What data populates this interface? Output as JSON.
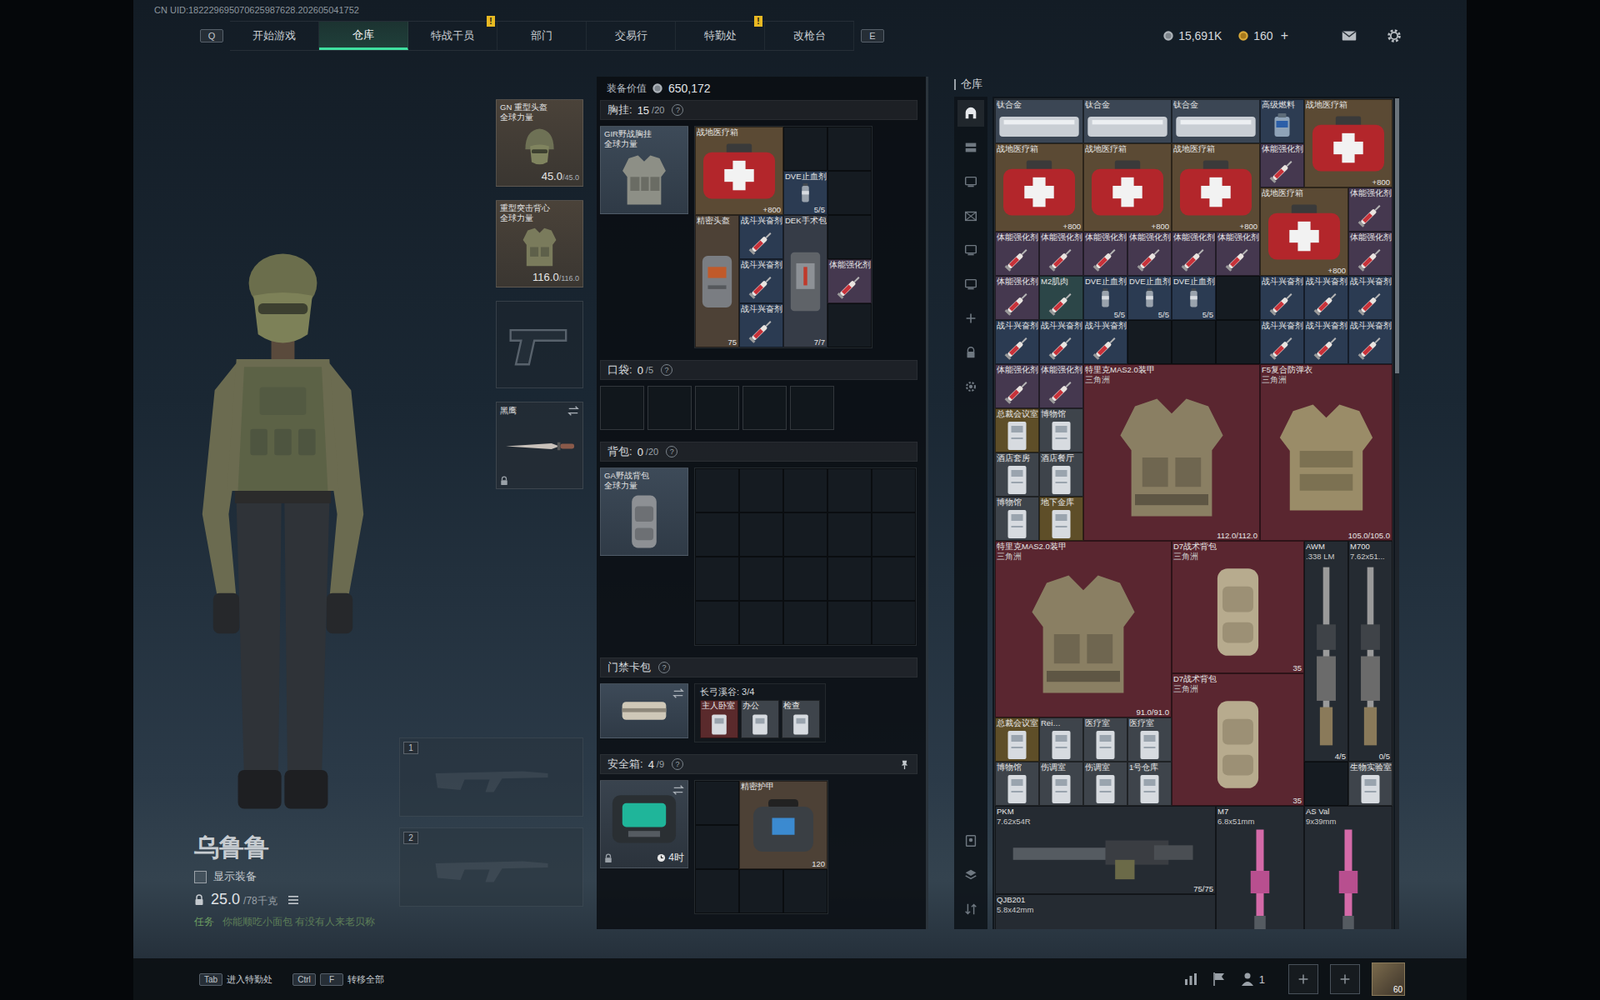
{
  "uid": "CN UID:182229695070625987628.202605041752",
  "nav": {
    "prev_key": "Q",
    "next_key": "E",
    "alert_mark": "!",
    "tabs": [
      {
        "label": "开始游戏",
        "selected": false,
        "alert": false
      },
      {
        "label": "仓库",
        "selected": true,
        "alert": false
      },
      {
        "label": "特战干员",
        "selected": false,
        "alert": true
      },
      {
        "label": "部门",
        "selected": false,
        "alert": false
      },
      {
        "label": "交易行",
        "selected": false,
        "alert": false
      },
      {
        "label": "特勤处",
        "selected": false,
        "alert": true
      },
      {
        "label": "改枪台",
        "selected": false,
        "alert": false
      }
    ]
  },
  "currency": {
    "coins": "15,691K",
    "bonds": "160",
    "add": "+"
  },
  "character": {
    "name": "乌鲁鲁",
    "show_gear": {
      "label": "显示装备",
      "checked": false
    },
    "weight": "25.0",
    "capacity": "/78千克",
    "task_label": "任务",
    "task": "你能顺吃小面包 有没有人来老贝称"
  },
  "gear": {
    "helmet": {
      "name": "GN 重型头盔",
      "brand": "全球力量",
      "durability": "45.0",
      "max": "/45.0"
    },
    "armor": {
      "name": "重型突击背心",
      "brand": "全球力量",
      "durability": "116.0",
      "max": "/116.0"
    },
    "pistol": {
      "empty": true
    },
    "melee": {
      "name": "黑鹰",
      "locked": true
    }
  },
  "weapons": [
    {
      "slot": "1",
      "empty": true
    },
    {
      "slot": "2",
      "empty": true
    }
  ],
  "loadout": {
    "value_label": "装备价值",
    "value": "650,172",
    "help": "?",
    "chest": {
      "label": "胸挂:",
      "count": "15",
      "capacity": "/20",
      "container": {
        "name": "GIR野战胸挂",
        "brand": "全球力量"
      },
      "items": [
        {
          "name": "战地医疗箱",
          "kind": "medkit",
          "sub": "",
          "value": "+800",
          "color": "#5b4a34"
        },
        {
          "name": "",
          "kind": "empty",
          "sub": "",
          "value": "",
          "color": "#151b21"
        },
        {
          "name": "",
          "kind": "empty",
          "sub": "",
          "value": "",
          "color": "#151b21"
        },
        {
          "name": "DVE止血剂",
          "kind": "spray",
          "sub": "",
          "value": "5/5",
          "color": "#2b3b52"
        },
        {
          "name": "",
          "kind": "empty",
          "sub": "",
          "value": "",
          "color": "#151b21"
        },
        {
          "name": "精密头盔",
          "kind": "helmet",
          "sub": "",
          "value": "75",
          "color": "#4d4136"
        },
        {
          "name": "战斗兴奋剂",
          "kind": "syringe",
          "sub": "",
          "value": "",
          "color": "#2b3b52"
        },
        {
          "name": "DEK手术包",
          "kind": "surgkit",
          "sub": "",
          "value": "7/7",
          "color": "#363c47"
        },
        {
          "name": "",
          "kind": "empty",
          "sub": "",
          "value": "",
          "color": "#151b21"
        },
        {
          "name": "战斗兴奋剂",
          "kind": "syringe",
          "sub": "",
          "value": "",
          "color": "#2b3b52"
        },
        {
          "name": "体能强化剂",
          "kind": "syringe",
          "sub": "",
          "value": "",
          "color": "#45384f"
        },
        {
          "name": "战斗兴奋剂",
          "kind": "syringe",
          "sub": "",
          "value": "",
          "color": "#2b3b52"
        },
        {
          "name": "",
          "kind": "empty",
          "sub": "",
          "value": "",
          "color": "#151b21"
        }
      ]
    },
    "pocket": {
      "label": "口袋:",
      "count": "0",
      "capacity": "/5"
    },
    "backpack": {
      "label": "背包:",
      "count": "0",
      "capacity": "/20",
      "container": {
        "name": "GA野战背包",
        "brand": "全球力量"
      }
    },
    "keycards": {
      "label": "门禁卡包",
      "map": "长弓溪谷: 3/4",
      "cards": [
        {
          "name": "主人卧室",
          "color": "#5a2a2c"
        },
        {
          "name": "办公",
          "color": "#3e444b"
        },
        {
          "name": "检查",
          "color": "#3e444b"
        }
      ]
    },
    "safebox": {
      "label": "安全箱:",
      "count": "4",
      "capacity": "/9",
      "timer": "4时",
      "items": [
        {
          "name": "",
          "kind": "empty",
          "sub": "",
          "value": "",
          "color": "#151b21"
        },
        {
          "name": "精密护甲",
          "kind": "armorcase",
          "sub": "",
          "value": "120",
          "color": "#4d4136"
        },
        {
          "name": "",
          "kind": "empty",
          "sub": "",
          "value": "",
          "color": "#151b21"
        },
        {
          "name": "",
          "kind": "empty",
          "sub": "",
          "value": "",
          "color": "#151b21"
        },
        {
          "name": "",
          "kind": "empty",
          "sub": "",
          "value": "",
          "color": "#151b21"
        },
        {
          "name": "",
          "kind": "empty",
          "sub": "",
          "value": "",
          "color": "#151b21"
        }
      ]
    }
  },
  "warehouse": {
    "title": "仓库",
    "sidebar": [
      {
        "kind": "home",
        "selected": true
      },
      {
        "kind": "stash",
        "selected": false
      },
      {
        "kind": "monitor",
        "selected": false
      },
      {
        "kind": "crate",
        "selected": false
      },
      {
        "kind": "monitor",
        "selected": false
      },
      {
        "kind": "monitor",
        "selected": false
      },
      {
        "kind": "add",
        "selected": false
      },
      {
        "kind": "lock",
        "selected": false
      },
      {
        "kind": "settings",
        "selected": false
      }
    ],
    "sidebar_bottom": [
      {
        "kind": "badge",
        "selected": false
      },
      {
        "kind": "layers",
        "selected": false
      },
      {
        "kind": "sort",
        "selected": false
      }
    ],
    "items": [
      {
        "name": "钛合金",
        "kind": "ingot",
        "sub": "",
        "value": "",
        "color": "#3b4654"
      },
      {
        "name": "钛合金",
        "kind": "ingot",
        "sub": "",
        "value": "",
        "color": "#3b4654"
      },
      {
        "name": "钛合金",
        "kind": "ingot",
        "sub": "",
        "value": "",
        "color": "#3b4654"
      },
      {
        "name": "高级燃料",
        "kind": "fuel",
        "sub": "",
        "value": "",
        "color": "#2d3c52"
      },
      {
        "name": "战地医疗箱",
        "kind": "medkit",
        "sub": "",
        "value": "+800",
        "color": "#5b4a34"
      },
      {
        "name": "战地医疗箱",
        "kind": "medkit",
        "sub": "",
        "value": "+800",
        "color": "#5b4a34"
      },
      {
        "name": "战地医疗箱",
        "kind": "medkit",
        "sub": "",
        "value": "+800",
        "color": "#5b4a34"
      },
      {
        "name": "战地医疗箱",
        "kind": "medkit",
        "sub": "",
        "value": "+800",
        "color": "#5b4a34"
      },
      {
        "name": "体能强化剂",
        "kind": "syringe",
        "sub": "",
        "value": "",
        "color": "#45384f"
      },
      {
        "name": "战地医疗箱",
        "kind": "medkit",
        "sub": "",
        "value": "+800",
        "color": "#5b4a34"
      },
      {
        "name": "体能强化剂",
        "kind": "syringe",
        "sub": "",
        "value": "",
        "color": "#45384f"
      },
      {
        "name": "体能强化剂",
        "kind": "syringe",
        "sub": "",
        "value": "",
        "color": "#45384f"
      },
      {
        "name": "体能强化剂",
        "kind": "syringe",
        "sub": "",
        "value": "",
        "color": "#45384f"
      },
      {
        "name": "体能强化剂",
        "kind": "syringe",
        "sub": "",
        "value": "",
        "color": "#45384f"
      },
      {
        "name": "体能强化剂",
        "kind": "syringe",
        "sub": "",
        "value": "",
        "color": "#45384f"
      },
      {
        "name": "体能强化剂",
        "kind": "syringe",
        "sub": "",
        "value": "",
        "color": "#45384f"
      },
      {
        "name": "体能强化剂",
        "kind": "syringe",
        "sub": "",
        "value": "",
        "color": "#45384f"
      },
      {
        "name": "体能强化剂",
        "kind": "syringe",
        "sub": "",
        "value": "",
        "color": "#45384f"
      },
      {
        "name": "体能强化剂",
        "kind": "syringe",
        "sub": "",
        "value": "",
        "color": "#45384f"
      },
      {
        "name": "M2肌肉",
        "kind": "syringe",
        "sub": "",
        "value": "",
        "color": "#2c4648"
      },
      {
        "name": "DVE止血剂",
        "kind": "spray",
        "sub": "",
        "value": "5/5",
        "color": "#2b3b52"
      },
      {
        "name": "DVE止血剂",
        "kind": "spray",
        "sub": "",
        "value": "5/5",
        "color": "#2b3b52"
      },
      {
        "name": "DVE止血剂",
        "kind": "spray",
        "sub": "",
        "value": "5/5",
        "color": "#2b3b52"
      },
      {
        "name": "",
        "kind": "empty",
        "sub": "",
        "value": "",
        "color": "#151b21"
      },
      {
        "name": "战斗兴奋剂",
        "kind": "syringe",
        "sub": "",
        "value": "",
        "color": "#2b3b52"
      },
      {
        "name": "战斗兴奋剂",
        "kind": "syringe",
        "sub": "",
        "value": "",
        "color": "#2b3b52"
      },
      {
        "name": "战斗兴奋剂",
        "kind": "syringe",
        "sub": "",
        "value": "",
        "color": "#2b3b52"
      },
      {
        "name": "战斗兴奋剂",
        "kind": "syringe",
        "sub": "",
        "value": "",
        "color": "#2b3b52"
      },
      {
        "name": "战斗兴奋剂",
        "kind": "syringe",
        "sub": "",
        "value": "",
        "color": "#2b3b52"
      },
      {
        "name": "战斗兴奋剂",
        "kind": "syringe",
        "sub": "",
        "value": "",
        "color": "#2b3b52"
      },
      {
        "name": "",
        "kind": "empty",
        "sub": "",
        "value": "",
        "color": "#151b21"
      },
      {
        "name": "",
        "kind": "empty",
        "sub": "",
        "value": "",
        "color": "#151b21"
      },
      {
        "name": "",
        "kind": "empty",
        "sub": "",
        "value": "",
        "color": "#151b21"
      },
      {
        "name": "战斗兴奋剂",
        "kind": "syringe",
        "sub": "",
        "value": "",
        "color": "#2b3b52"
      },
      {
        "name": "战斗兴奋剂",
        "kind": "syringe",
        "sub": "",
        "value": "",
        "color": "#2b3b52"
      },
      {
        "name": "战斗兴奋剂",
        "kind": "syringe",
        "sub": "",
        "value": "",
        "color": "#2b3b52"
      },
      {
        "name": "体能强化剂",
        "kind": "syringe",
        "sub": "",
        "value": "",
        "color": "#45384f"
      },
      {
        "name": "体能强化剂",
        "kind": "syringe",
        "sub": "",
        "value": "",
        "color": "#45384f"
      },
      {
        "name": "特里克MAS2.0装甲",
        "kind": "armor",
        "sub": "三角洲",
        "value": "112.0/112.0",
        "color": "#5a2630"
      },
      {
        "name": "F5复合防弹衣",
        "kind": "vest",
        "sub": "三角洲",
        "value": "105.0/105.0",
        "color": "#5a2630"
      },
      {
        "name": "总裁会议室",
        "kind": "card",
        "sub": "",
        "value": "",
        "color": "#5e4e28"
      },
      {
        "name": "博物馆",
        "kind": "card",
        "sub": "",
        "value": "",
        "color": "#3e444b"
      },
      {
        "name": "酒店套房",
        "kind": "card",
        "sub": "",
        "value": "",
        "color": "#3e444b"
      },
      {
        "name": "酒店餐厅",
        "kind": "card",
        "sub": "",
        "value": "",
        "color": "#3e444b"
      },
      {
        "name": "博物馆",
        "kind": "card",
        "sub": "",
        "value": "",
        "color": "#3e444b"
      },
      {
        "name": "地下金库",
        "kind": "card",
        "sub": "",
        "value": "",
        "color": "#5e4e28"
      },
      {
        "name": "特里克MAS2.0装甲",
        "kind": "armor",
        "sub": "三角洲",
        "value": "91.0/91.0",
        "color": "#5a2630"
      },
      {
        "name": "D7战术背包",
        "kind": "pack",
        "sub": "三角洲",
        "value": "35",
        "color": "#5a2630"
      },
      {
        "name": "AWM",
        "kind": "rifle",
        "sub": ".338 LM",
        "value": "4/5",
        "color": "#252b32"
      },
      {
        "name": "M700",
        "kind": "rifle",
        "sub": "7.62x51...",
        "value": "0/5",
        "color": "#252b32"
      },
      {
        "name": "D7战术背包",
        "kind": "pack",
        "sub": "三角洲",
        "value": "35",
        "color": "#5a2630"
      },
      {
        "name": "总裁会议室",
        "kind": "card",
        "sub": "",
        "value": "",
        "color": "#5e4e28"
      },
      {
        "name": "Rei…",
        "kind": "card",
        "sub": "",
        "value": "",
        "color": "#3e444b"
      },
      {
        "name": "医疗室",
        "kind": "card",
        "sub": "",
        "value": "",
        "color": "#3e444b"
      },
      {
        "name": "医疗室",
        "kind": "card",
        "sub": "",
        "value": "",
        "color": "#3e444b"
      },
      {
        "name": "博物馆",
        "kind": "card",
        "sub": "",
        "value": "",
        "color": "#3e444b"
      },
      {
        "name": "伤调室",
        "kind": "card",
        "sub": "",
        "value": "",
        "color": "#3e444b"
      },
      {
        "name": "伤调室",
        "kind": "card",
        "sub": "",
        "value": "",
        "color": "#3e444b"
      },
      {
        "name": "1号仓库",
        "kind": "card",
        "sub": "",
        "value": "",
        "color": "#3e444b"
      },
      {
        "name": "",
        "kind": "empty",
        "sub": "",
        "value": "",
        "color": "#151b21"
      },
      {
        "name": "生物实验室",
        "kind": "card",
        "sub": "",
        "value": "",
        "color": "#3e444b"
      },
      {
        "name": "PKM",
        "kind": "lmg",
        "sub": "7.62x54R",
        "value": "75/75",
        "color": "#252b32"
      },
      {
        "name": "M7",
        "kind": "smg",
        "sub": "6.8x51mm",
        "value": "",
        "color": "#252b32"
      },
      {
        "name": "AS Val",
        "kind": "smg",
        "sub": "9x39mm",
        "value": "",
        "color": "#252b32"
      },
      {
        "name": "QJB201",
        "kind": "lmg",
        "sub": "5.8x42mm",
        "value": "",
        "color": "#252b32"
      }
    ]
  },
  "footer": {
    "hints": [
      {
        "keys": [
          "Tab"
        ],
        "label": "进入特勤处"
      },
      {
        "keys": [
          "Ctrl",
          "F"
        ],
        "label": "转移全部"
      }
    ],
    "squad": "1",
    "level": "60"
  }
}
